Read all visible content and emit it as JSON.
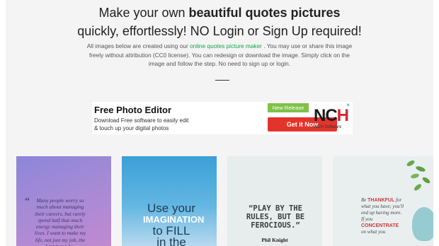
{
  "header": {
    "line1_prefix": "Make your own ",
    "line1_bold": "beautiful quotes pictures",
    "line2": "quickly, effortlessly! NO Login or Sign Up required!"
  },
  "description": {
    "part1": "All images below are created using our ",
    "link": "online quotes picture maker",
    "part2": " . You may use or share this image freely without attribution (CC0 license). You can redesign or download the image. Simply click on the image and follow the step. No need to sign up or login."
  },
  "ad": {
    "title": "Free Photo Editor",
    "subtitle": "Download Free software to easily edit & touch up your digital photos",
    "badge": "New Release",
    "button": "Get it Now",
    "brand_logo": "NCH",
    "brand_label": "NCH Software",
    "close_icon": "✕",
    "adchoices_icon": "▷"
  },
  "cards": [
    {
      "quote": "Many people worry so much about managing their careers, but rarely spend half that much energy managing their lives. I want to make my life, not just my job, the best it can be.",
      "quote_mark": "“"
    },
    {
      "line1": "Use your",
      "line2": "IMAGINATION",
      "line3": "to FILL",
      "line4": "in the"
    },
    {
      "quote": "“PLAY BY THE RULES, BUT BE FEROCIOUS.”",
      "author": "Phil Knight"
    },
    {
      "line1": "Be ",
      "line1_red": "THANKFUL",
      "line2": "for what you have; you'll end up having more. If you ",
      "line2_red": "CONCENTRATE",
      "line3": "on what you"
    }
  ]
}
